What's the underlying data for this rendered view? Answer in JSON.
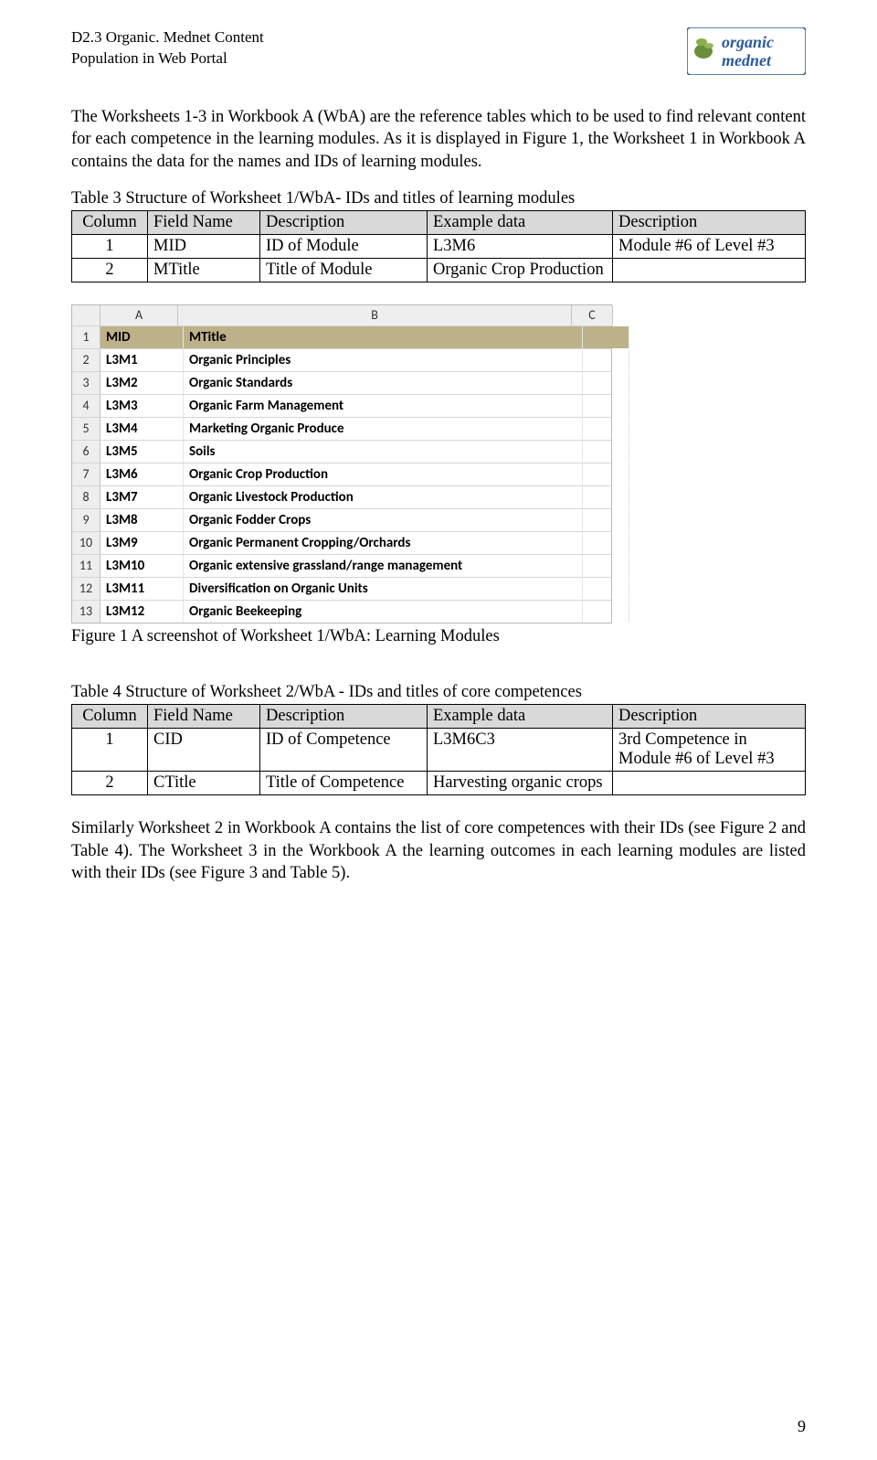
{
  "header": {
    "line1": "D2.3 Organic. Mednet Content",
    "line2": "Population in Web Portal",
    "logo_top": "organic",
    "logo_bottom": "mednet"
  },
  "para1": "The Worksheets 1-3 in Workbook A (WbA) are the reference tables which to be used to find relevant content for each competence in the learning modules. As it is displayed in Figure 1, the Worksheet 1 in Workbook A contains the data for the names and IDs of learning modules.",
  "table3": {
    "caption": "Table 3 Structure of Worksheet 1/WbA- IDs and titles of learning modules",
    "headers": [
      "Column",
      "Field Name",
      "Description",
      "Example data",
      "Description"
    ],
    "rows": [
      {
        "col": "1",
        "field": "MID",
        "desc": "ID of Module",
        "ex": "L3M6",
        "desc2": "Module #6 of Level #3"
      },
      {
        "col": "2",
        "field": "MTitle",
        "desc": "Title of Module",
        "ex": "Organic Crop Production",
        "desc2": ""
      }
    ]
  },
  "excel": {
    "col_headers": [
      "A",
      "B",
      "C"
    ],
    "row1": {
      "a": "MID",
      "b": "MTitle"
    },
    "rows": [
      {
        "n": "2",
        "a": "L3M1",
        "b": "Organic Principles"
      },
      {
        "n": "3",
        "a": "L3M2",
        "b": "Organic Standards"
      },
      {
        "n": "4",
        "a": "L3M3",
        "b": "Organic Farm Management"
      },
      {
        "n": "5",
        "a": "L3M4",
        "b": "Marketing Organic Produce"
      },
      {
        "n": "6",
        "a": "L3M5",
        "b": "Soils"
      },
      {
        "n": "7",
        "a": "L3M6",
        "b": "Organic Crop Production"
      },
      {
        "n": "8",
        "a": "L3M7",
        "b": "Organic Livestock Production"
      },
      {
        "n": "9",
        "a": "L3M8",
        "b": "Organic Fodder Crops"
      },
      {
        "n": "10",
        "a": "L3M9",
        "b": "Organic Permanent Cropping/Orchards"
      },
      {
        "n": "11",
        "a": "L3M10",
        "b": "Organic extensive grassland/range management"
      },
      {
        "n": "12",
        "a": "L3M11",
        "b": "Diversification on Organic Units"
      },
      {
        "n": "13",
        "a": "L3M12",
        "b": "Organic Beekeeping"
      }
    ]
  },
  "fig1_caption": "Figure 1 A screenshot of Worksheet 1/WbA: Learning Modules",
  "table4": {
    "caption": "Table 4 Structure of Worksheet 2/WbA - IDs and titles of core competences",
    "headers": [
      "Column",
      "Field Name",
      "Description",
      "Example data",
      "Description"
    ],
    "rows": [
      {
        "col": "1",
        "field": "CID",
        "desc": "ID of Competence",
        "ex": "L3M6C3",
        "desc2": "3rd Competence in Module #6 of Level #3"
      },
      {
        "col": "2",
        "field": "CTitle",
        "desc": "Title of Competence",
        "ex": "Harvesting organic crops",
        "desc2": ""
      }
    ]
  },
  "para2": "Similarly Worksheet 2 in Workbook A contains the list of core competences with their IDs (see Figure 2 and Table 4). The Worksheet 3 in the Workbook A the learning outcomes in each learning modules are listed with their IDs (see Figure 3 and Table 5).",
  "page_number": "9"
}
